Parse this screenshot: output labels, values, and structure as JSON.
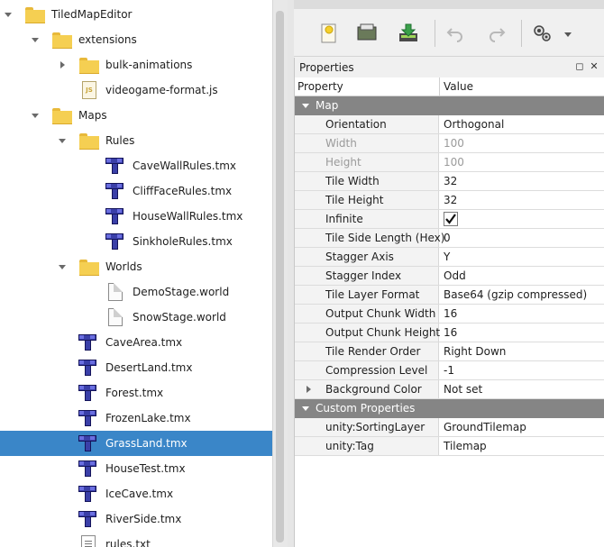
{
  "tree": {
    "items": [
      {
        "label": "TiledMapEditor",
        "icon": "folder-icon",
        "expanded": true
      },
      {
        "label": "extensions",
        "icon": "folder-icon",
        "expanded": true
      },
      {
        "label": "bulk-animations",
        "icon": "folder-icon",
        "expanded": false
      },
      {
        "label": "videogame-format.js",
        "icon": "js-file-icon"
      },
      {
        "label": "Maps",
        "icon": "folder-icon",
        "expanded": true
      },
      {
        "label": "Rules",
        "icon": "folder-icon",
        "expanded": true
      },
      {
        "label": "CaveWallRules.tmx",
        "icon": "tmx-file-icon"
      },
      {
        "label": "CliffFaceRules.tmx",
        "icon": "tmx-file-icon"
      },
      {
        "label": "HouseWallRules.tmx",
        "icon": "tmx-file-icon"
      },
      {
        "label": "SinkholeRules.tmx",
        "icon": "tmx-file-icon"
      },
      {
        "label": "Worlds",
        "icon": "folder-icon",
        "expanded": true
      },
      {
        "label": "DemoStage.world",
        "icon": "file-icon"
      },
      {
        "label": "SnowStage.world",
        "icon": "file-icon"
      },
      {
        "label": "CaveArea.tmx",
        "icon": "tmx-file-icon"
      },
      {
        "label": "DesertLand.tmx",
        "icon": "tmx-file-icon"
      },
      {
        "label": "Forest.tmx",
        "icon": "tmx-file-icon"
      },
      {
        "label": "FrozenLake.tmx",
        "icon": "tmx-file-icon"
      },
      {
        "label": "GrassLand.tmx",
        "icon": "tmx-file-icon",
        "selected": true
      },
      {
        "label": "HouseTest.tmx",
        "icon": "tmx-file-icon"
      },
      {
        "label": "IceCave.tmx",
        "icon": "tmx-file-icon"
      },
      {
        "label": "RiverSide.tmx",
        "icon": "tmx-file-icon"
      },
      {
        "label": "rules.txt",
        "icon": "text-file-icon"
      }
    ]
  },
  "toolbar": {
    "icons": [
      "new-file-icon",
      "open-file-icon",
      "save-file-icon",
      "undo-icon",
      "redo-icon",
      "settings-icon"
    ]
  },
  "properties": {
    "title": "Properties",
    "column_property": "Property",
    "column_value": "Value",
    "map_group": "Map",
    "rows": [
      {
        "name": "Orientation",
        "value": "Orthogonal"
      },
      {
        "name": "Width",
        "value": "100",
        "disabled": true
      },
      {
        "name": "Height",
        "value": "100",
        "disabled": true
      },
      {
        "name": "Tile Width",
        "value": "32"
      },
      {
        "name": "Tile Height",
        "value": "32"
      },
      {
        "name": "Infinite",
        "value": "",
        "checkbox": true,
        "checked": true
      },
      {
        "name": "Tile Side Length (Hex)",
        "value": "0"
      },
      {
        "name": "Stagger Axis",
        "value": "Y"
      },
      {
        "name": "Stagger Index",
        "value": "Odd"
      },
      {
        "name": "Tile Layer Format",
        "value": "Base64 (gzip compressed)"
      },
      {
        "name": "Output Chunk Width",
        "value": "16"
      },
      {
        "name": "Output Chunk Height",
        "value": "16"
      },
      {
        "name": "Tile Render Order",
        "value": "Right Down"
      },
      {
        "name": "Compression Level",
        "value": "-1"
      },
      {
        "name": "Background Color",
        "value": "Not set",
        "expandable": true
      }
    ],
    "custom_group": "Custom Properties",
    "custom_rows": [
      {
        "name": "unity:SortingLayer",
        "value": "GroundTilemap"
      },
      {
        "name": "unity:Tag",
        "value": "Tilemap"
      }
    ]
  },
  "colors": {
    "selection": "#3a86c8",
    "group_header": "#858585",
    "folder": "#f5cf52",
    "tmx_icon": "#3a3fa8"
  }
}
